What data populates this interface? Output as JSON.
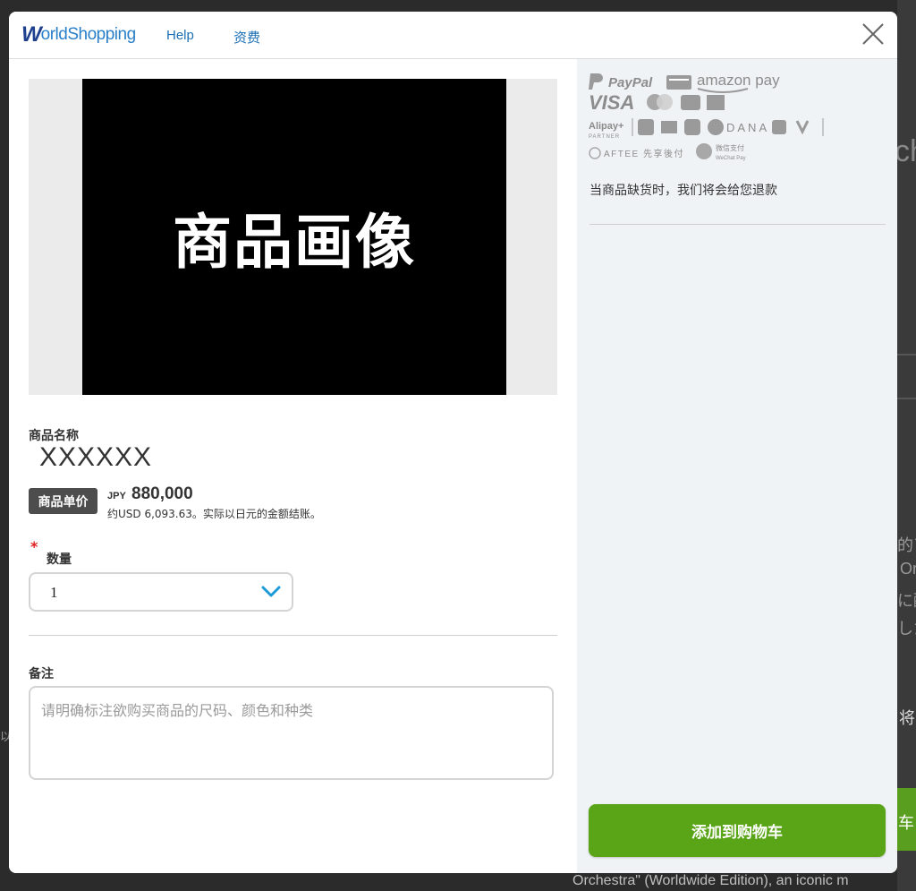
{
  "header": {
    "logo_w": "W",
    "logo_rest": "orldShopping",
    "nav": [
      {
        "label": "Help"
      },
      {
        "label": "资费"
      }
    ]
  },
  "product": {
    "image_text": "商品画像",
    "name_label": "商品名称",
    "name": "XXXXXX",
    "price_badge": "商品单价",
    "price_currency": "JPY",
    "price_amount": "880,000",
    "price_usd_note": "约USD 6,093.63。实际以日元的金额结账。",
    "quantity_label": "数量",
    "quantity_value": "1",
    "notes_label": "备注",
    "notes_placeholder": "请明确标注欲购买商品的尺码、颜色和种类"
  },
  "sidebar": {
    "payment_logos": {
      "paypal": "PayPal",
      "amazon_pay": "amazon pay",
      "visa": "VISA",
      "alipay": "Alipay+",
      "alipay_sub": "PARTNER",
      "dana": "DANA",
      "aftee": "AFTEE 先享後付",
      "wechat": "微信支付",
      "wechat_sub": "WeChat Pay"
    },
    "refund_note": "当商品缺货时，我们将会给您退款",
    "add_to_cart": "添加到购物车"
  },
  "background": {
    "peek_right_1": "ch",
    "peek_right_2": "的ア",
    "peek_right_3": "Or",
    "peek_right_4": "に醸",
    "peek_right_5": "した",
    "peek_right_6": "将",
    "peek_right_7": "车",
    "peek_left_1": "以",
    "peek_bottom": "Orchestra\" (Worldwide Edition), an iconic m"
  },
  "colors": {
    "accent_green": "#5aa417",
    "link_blue": "#1a6fb5",
    "required_red": "#e02020"
  }
}
